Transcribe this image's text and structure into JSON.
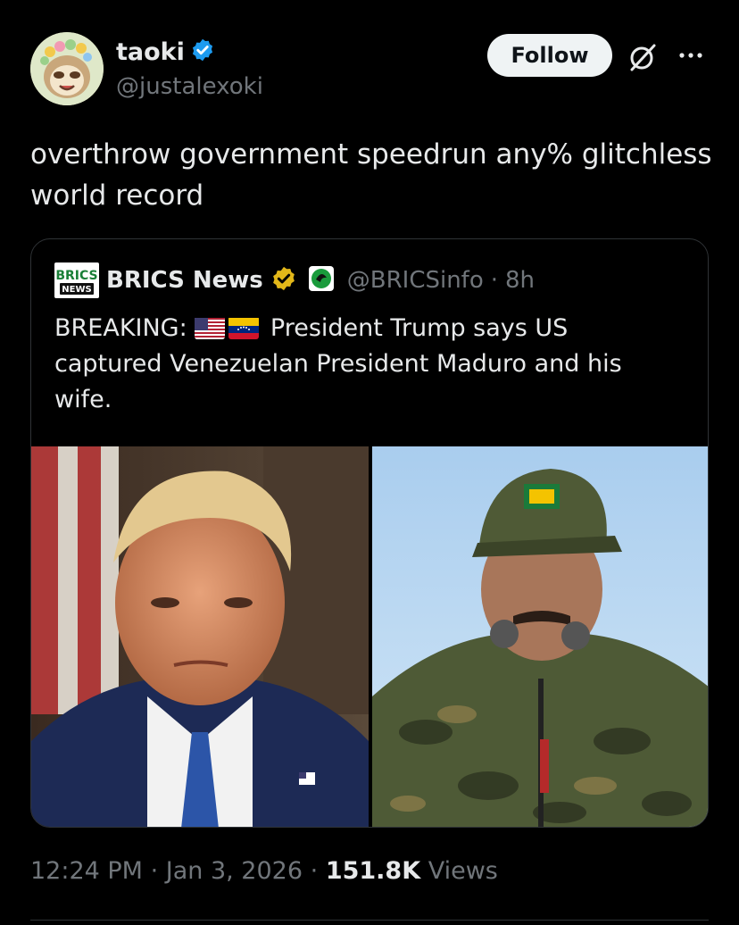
{
  "author": {
    "name": "taoki",
    "handle": "@justalexoki",
    "verified": true
  },
  "header": {
    "follow_label": "Follow",
    "grok_icon": "grok-icon",
    "more_icon": "more-icon"
  },
  "tweet": {
    "text": "overthrow government speedrun any% glitchless world record"
  },
  "quote": {
    "name": "BRICS News",
    "handle": "@BRICSinfo",
    "time": "8h",
    "separator": "·",
    "text_prefix": "BREAKING:",
    "text_body": "President Trump says US captured Venezuelan President Maduro and his wife.",
    "logo_text": "BRICS",
    "logo_sub": "NEWS"
  },
  "meta": {
    "time": "12:24 PM",
    "date": "Jan 3, 2026",
    "views_count": "151.8K",
    "views_label": "Views",
    "separator": "·"
  },
  "colors": {
    "verified_blue": "#1d9bf0",
    "verified_gold": "#e2b719",
    "background": "#000000",
    "muted": "#71767b"
  }
}
